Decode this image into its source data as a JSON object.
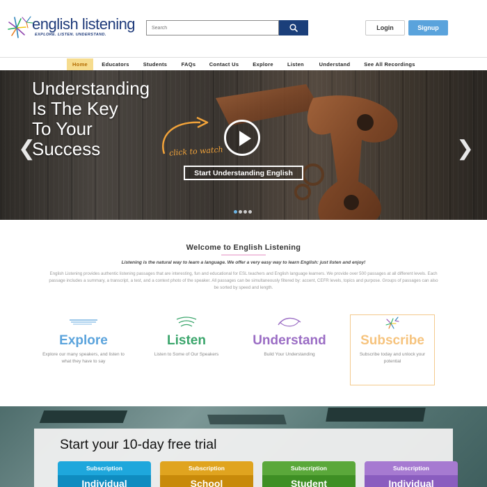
{
  "brand": {
    "title": "english listening",
    "tagline": "EXPLORE. LISTEN. UNDERSTAND.",
    "colors": {
      "navy": "#1e3a7a",
      "accent_blue": "#5aa3dc",
      "nav_active": "#f6dc8e"
    }
  },
  "header": {
    "search": {
      "placeholder": "Search",
      "button_icon": "search-icon"
    },
    "login_label": "Login",
    "signup_label": "Signup"
  },
  "nav": {
    "items": [
      {
        "label": "Home",
        "active": true
      },
      {
        "label": "Educators"
      },
      {
        "label": "Students"
      },
      {
        "label": "FAQs"
      },
      {
        "label": "Contact Us"
      },
      {
        "label": "Explore"
      },
      {
        "label": "Listen"
      },
      {
        "label": "Understand"
      },
      {
        "label": "See All Recordings"
      }
    ]
  },
  "hero": {
    "lines": [
      "Understanding",
      "Is The Key",
      "To Your",
      "Success"
    ],
    "click_to_watch": "click to watch",
    "cta_label": "Start Understanding English",
    "prev_icon": "chevron-left-icon",
    "next_icon": "chevron-right-icon",
    "play_icon": "play-icon",
    "slide_count": 4,
    "active_slide": 1
  },
  "welcome": {
    "title": "Welcome to English Listening",
    "lead": "Listening is the natural way to learn a language. We offer a very easy way to learn English: just listen and enjoy!",
    "body": "English Listening provides authentic listening passages that are interesting, fun and educational for ESL teachers and English language learners. We provide over 500 passages at all different levels. Each passage includes a summary, a transcript, a test, and a context photo of the speaker. All passages can be simultaneously filtered by: accent, CEFR levels, topics and purpose. Groups of passages can also be sorted by speed and length."
  },
  "features": [
    {
      "title": "Explore",
      "desc": "Explore our many speakers, and listen to what they have to say",
      "color": "#5aa3dc",
      "icon": "explore-lines-icon"
    },
    {
      "title": "Listen",
      "desc": "Listen to Some of Our Speakers",
      "color": "#3aa56b",
      "icon": "sound-waves-icon"
    },
    {
      "title": "Understand",
      "desc": "Build Your Understanding",
      "color": "#9a6cc4",
      "icon": "understand-swirl-icon"
    },
    {
      "title": "Subscribe",
      "desc": "Subscribe today and unlock your potential",
      "color": "#f6c37d",
      "icon": "sparkle-logo-icon"
    }
  ],
  "trial": {
    "title": "Start your 10-day free trial",
    "cards": [
      {
        "label": "Subscription",
        "name": "Individual",
        "color": "#1ea7dc",
        "color_dark": "#0f8cc0"
      },
      {
        "label": "Subscription",
        "name": "School",
        "color": "#e0a41f",
        "color_dark": "#c88a0a"
      },
      {
        "label": "Subscription",
        "name": "Student",
        "color": "#5aa83a",
        "color_dark": "#3e8f24"
      },
      {
        "label": "Subscription",
        "name": "Individual",
        "color": "#a67ad1",
        "color_dark": "#8a5dbf"
      }
    ]
  }
}
